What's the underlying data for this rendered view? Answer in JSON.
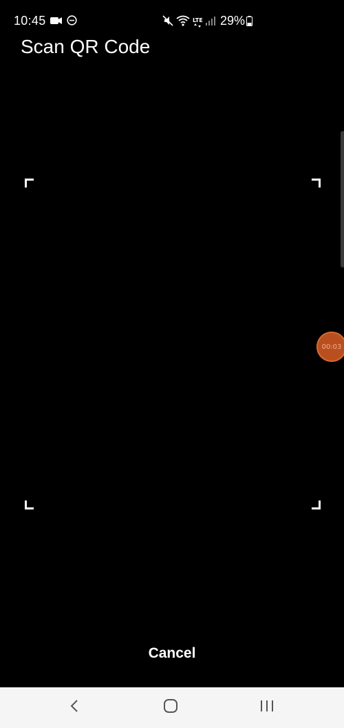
{
  "status_bar": {
    "time": "10:45",
    "battery_percent": "29%",
    "left_icons": [
      "video-camera-icon",
      "do-not-disturb-icon"
    ],
    "right_icons": [
      "mute-icon",
      "wifi-icon",
      "lte-icon",
      "signal-icon",
      "battery-icon"
    ],
    "lte_label": "LTE"
  },
  "header": {
    "title": "Scan QR Code"
  },
  "record_bubble": {
    "label": "00:03"
  },
  "footer": {
    "cancel_label": "Cancel"
  },
  "nav_bar": {
    "buttons": [
      "back-icon",
      "home-icon",
      "recents-icon"
    ]
  },
  "colors": {
    "background": "#000000",
    "text": "#ffffff",
    "nav_bar_bg": "#f5f5f5",
    "record_bubble": "#b94e1f"
  }
}
